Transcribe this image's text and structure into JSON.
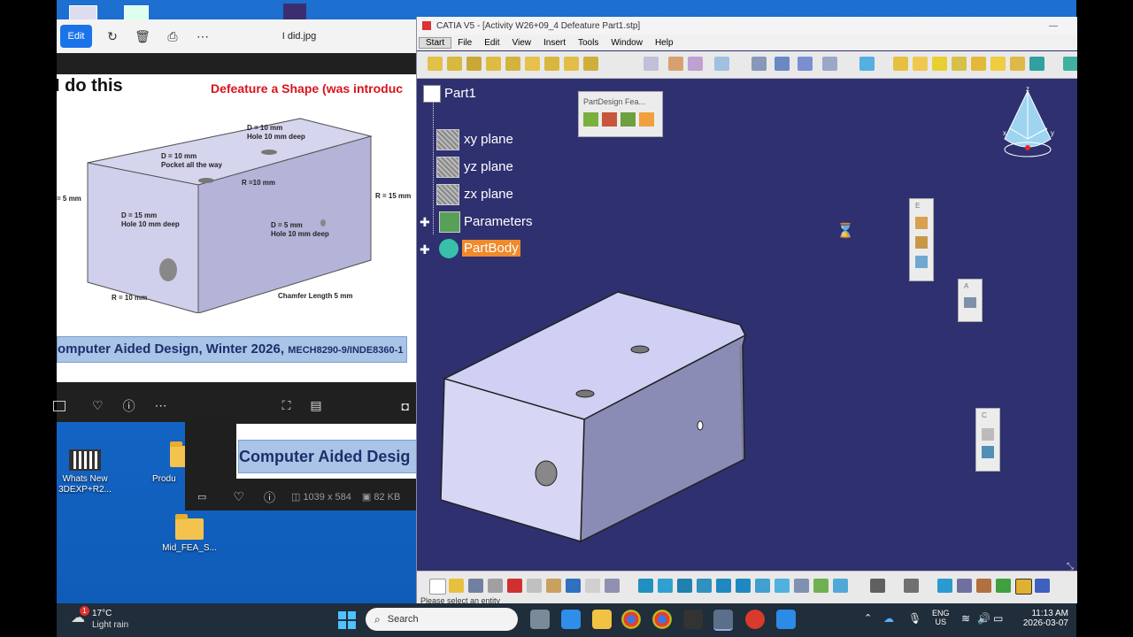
{
  "desktop": {
    "icons": [
      {
        "label": "Whats New 3DEXP+R2..."
      },
      {
        "label": "Produ"
      },
      {
        "label": "Mid_FEA_S..."
      }
    ]
  },
  "photos": {
    "edit_label": "Edit",
    "filename": "I did.jpg",
    "image": {
      "heading": "I do this",
      "red_heading": "Defeature a Shape (was introduc",
      "annotations": [
        "D = 10 mm\nHole 10 mm deep",
        "D = 10 mm\nPocket all the way",
        "R =10 mm",
        "R = 15 mm",
        "= 5 mm",
        "D = 15 mm\nHole 10 mm deep",
        "D = 5 mm\nHole 10 mm deep",
        "R = 10 mm",
        "Chamfer Length 5 mm"
      ],
      "banner": "omputer Aided Design, Winter 2026,",
      "banner_small": "MECH8290-9/INDE8360-1"
    }
  },
  "photos2": {
    "banner": "Computer Aided Desig",
    "dimensions": "1039 x 584",
    "size": "82 KB"
  },
  "catia": {
    "title": "CATIA V5 - [Activity W26+09_4 Defeature Part1.stp]",
    "menu": [
      "Start",
      "File",
      "Edit",
      "View",
      "Insert",
      "Tools",
      "Window",
      "Help"
    ],
    "tree": {
      "root": "Part1",
      "items": [
        "xy plane",
        "yz plane",
        "zx plane",
        "Parameters",
        "PartBody"
      ]
    },
    "floating_toolbar": "PartDesign Fea...",
    "mini_toolbars": [
      "E",
      "A",
      "C"
    ],
    "compass_labels": [
      "z",
      "x",
      "y"
    ],
    "status": "Please select an entity"
  },
  "taskbar": {
    "weather_temp": "17°C",
    "weather_desc": "Light rain",
    "weather_badge": "1",
    "search_placeholder": "Search",
    "lang1": "ENG",
    "lang2": "US",
    "time": "11:13 AM",
    "date": "2026-03-07"
  },
  "colors": {
    "catia_bg": "#2f3070",
    "partbody_highlight": "#f08a2c",
    "desktop_blue": "#1466c8",
    "banner_blue": "#a9c4e6",
    "red_heading": "#d8141c"
  }
}
